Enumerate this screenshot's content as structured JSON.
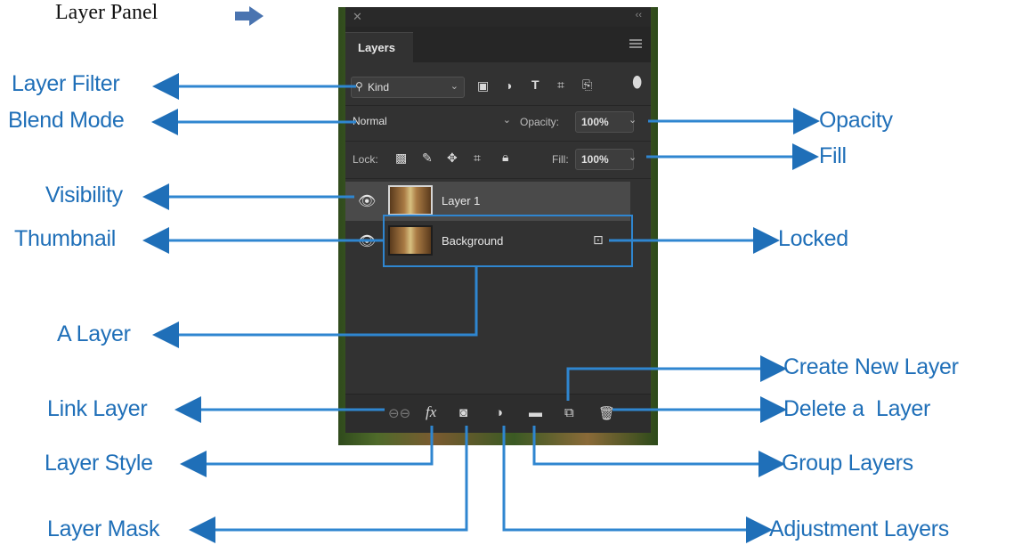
{
  "heading": "Layer Panel",
  "panel": {
    "tab_label": "Layers",
    "filter": {
      "value": "Kind",
      "icons": [
        "image-filter-icon",
        "adjustment-filter-icon",
        "type-filter-icon",
        "shape-filter-icon",
        "smart-object-filter-icon",
        "filter-toggle-icon"
      ]
    },
    "blend": {
      "value": "Normal",
      "opacity_label": "Opacity:",
      "opacity_value": "100%"
    },
    "lock": {
      "label": "Lock:",
      "icons": [
        "lock-transparent-icon",
        "lock-image-icon",
        "lock-position-icon",
        "lock-artboard-icon",
        "lock-all-icon"
      ],
      "fill_label": "Fill:",
      "fill_value": "100%"
    },
    "layers": [
      {
        "name": "Layer 1",
        "visible": true,
        "selected": true
      },
      {
        "name": "Background",
        "visible": true,
        "locked": true
      }
    ],
    "footer_icons": [
      "link-icon",
      "fx-icon",
      "mask-icon",
      "adjustment-icon",
      "folder-icon",
      "new-layer-icon",
      "trash-icon"
    ]
  },
  "annotations": {
    "layer_filter": "Layer Filter",
    "blend_mode": "Blend Mode",
    "visibility": "Visibility",
    "thumbnail": "Thumbnail",
    "a_layer": "A Layer",
    "link_layer": "Link Layer",
    "layer_style": "Layer Style",
    "layer_mask": "Layer Mask",
    "opacity": "Opacity",
    "fill": "Fill",
    "locked": "Locked",
    "create_new_layer": "Create New Layer",
    "delete_layer": "Delete a  Layer",
    "group_layers": "Group Layers",
    "adjustment_layers": "Adjustment Layers"
  },
  "colors": {
    "annotation_blue": "#1f6fb8",
    "panel_bg": "#323232"
  }
}
